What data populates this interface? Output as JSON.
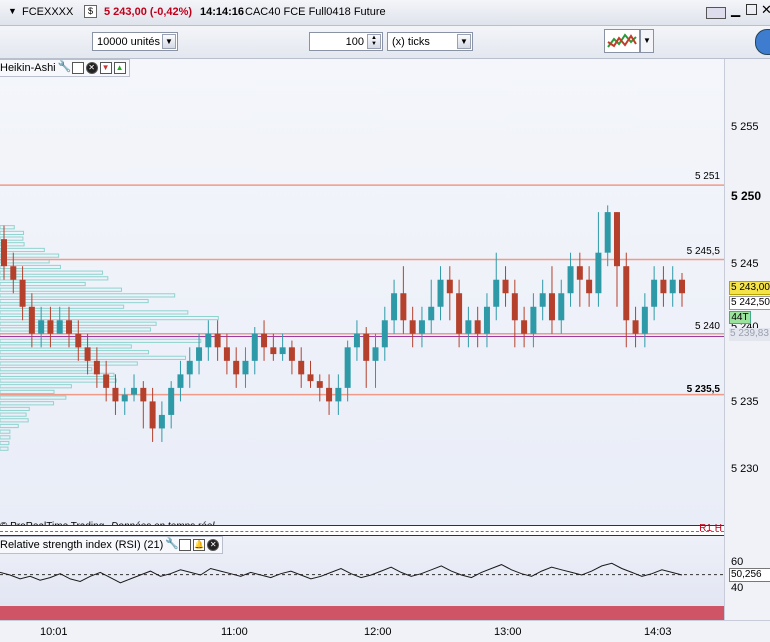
{
  "titlebar": {
    "instrument": "FCEXXXX",
    "price_change": "5 243,00 (-0,42%)",
    "time": "14:14:16",
    "description": "CAC40 FCE Full0418 Future"
  },
  "toolbar": {
    "quantity": "10000 unités",
    "ticks_value": "100",
    "ticks_unit": "(x) ticks"
  },
  "price_panel": {
    "label": "Heikin-Ashi",
    "footer": "© ProRealTime Trading",
    "footer_note": "Données en temps réel",
    "corner_label": "R1 H",
    "levels": [
      "5 251",
      "5 245,5",
      "5 240",
      "5 235,5"
    ],
    "yaxis_ticks": [
      "5 255",
      "5 250",
      "5 245",
      "5 240",
      "5 235",
      "5 230"
    ],
    "last_price": "5 243,00",
    "price_2": "5 242,50",
    "volume_tag": "44T",
    "faded_price": "5 239,83"
  },
  "rsi_panel": {
    "label": "Relative strength index (RSI) (21)",
    "ticks": [
      "60",
      "40"
    ],
    "value": "50,256"
  },
  "time_axis": [
    "10:01",
    "11:00",
    "12:00",
    "13:00",
    "14:03"
  ],
  "colors": {
    "up": "#2e9aa8",
    "down": "#b5412d",
    "level_line": "#f29a88",
    "purple_line": "#9a3aa3",
    "profile": "#8fd3cf",
    "last_price_bg": "#f5e34a",
    "volume_bg": "#9be39d"
  },
  "chart_data": {
    "type": "candlestick",
    "ylim": [
      5227,
      5257
    ],
    "candles": [
      {
        "o": 5247,
        "c": 5245,
        "h": 5248,
        "l": 5244
      },
      {
        "o": 5245,
        "c": 5244,
        "h": 5246,
        "l": 5243
      },
      {
        "o": 5244,
        "c": 5242,
        "h": 5245,
        "l": 5241
      },
      {
        "o": 5242,
        "c": 5240,
        "h": 5243,
        "l": 5239
      },
      {
        "o": 5240,
        "c": 5241,
        "h": 5242,
        "l": 5239
      },
      {
        "o": 5241,
        "c": 5240,
        "h": 5242,
        "l": 5239
      },
      {
        "o": 5240,
        "c": 5241,
        "h": 5242,
        "l": 5240
      },
      {
        "o": 5241,
        "c": 5240,
        "h": 5242,
        "l": 5239
      },
      {
        "o": 5240,
        "c": 5239,
        "h": 5241,
        "l": 5238
      },
      {
        "o": 5239,
        "c": 5238,
        "h": 5240,
        "l": 5237
      },
      {
        "o": 5238,
        "c": 5237,
        "h": 5239,
        "l": 5236
      },
      {
        "o": 5237,
        "c": 5236,
        "h": 5238,
        "l": 5235
      },
      {
        "o": 5236,
        "c": 5235,
        "h": 5237,
        "l": 5234
      },
      {
        "o": 5235,
        "c": 5235.5,
        "h": 5236,
        "l": 5234
      },
      {
        "o": 5235.5,
        "c": 5236,
        "h": 5237,
        "l": 5235
      },
      {
        "o": 5236,
        "c": 5235,
        "h": 5236.5,
        "l": 5233
      },
      {
        "o": 5235,
        "c": 5233,
        "h": 5236,
        "l": 5232
      },
      {
        "o": 5233,
        "c": 5234,
        "h": 5235,
        "l": 5232
      },
      {
        "o": 5234,
        "c": 5236,
        "h": 5236.5,
        "l": 5233
      },
      {
        "o": 5236,
        "c": 5237,
        "h": 5238,
        "l": 5235
      },
      {
        "o": 5237,
        "c": 5238,
        "h": 5239,
        "l": 5236
      },
      {
        "o": 5238,
        "c": 5239,
        "h": 5240,
        "l": 5237
      },
      {
        "o": 5239,
        "c": 5240,
        "h": 5241,
        "l": 5238
      },
      {
        "o": 5240,
        "c": 5239,
        "h": 5241,
        "l": 5238
      },
      {
        "o": 5239,
        "c": 5238,
        "h": 5240,
        "l": 5237
      },
      {
        "o": 5238,
        "c": 5237,
        "h": 5239,
        "l": 5236
      },
      {
        "o": 5237,
        "c": 5238,
        "h": 5239,
        "l": 5236
      },
      {
        "o": 5238,
        "c": 5240,
        "h": 5240.5,
        "l": 5237
      },
      {
        "o": 5240,
        "c": 5239,
        "h": 5241,
        "l": 5238
      },
      {
        "o": 5239,
        "c": 5238.5,
        "h": 5240,
        "l": 5238
      },
      {
        "o": 5238.5,
        "c": 5239,
        "h": 5240,
        "l": 5238
      },
      {
        "o": 5239,
        "c": 5238,
        "h": 5239.5,
        "l": 5237
      },
      {
        "o": 5238,
        "c": 5237,
        "h": 5239,
        "l": 5236
      },
      {
        "o": 5237,
        "c": 5236.5,
        "h": 5238,
        "l": 5236
      },
      {
        "o": 5236.5,
        "c": 5236,
        "h": 5237,
        "l": 5235
      },
      {
        "o": 5236,
        "c": 5235,
        "h": 5237,
        "l": 5234
      },
      {
        "o": 5235,
        "c": 5236,
        "h": 5237,
        "l": 5234
      },
      {
        "o": 5236,
        "c": 5239,
        "h": 5239.5,
        "l": 5235
      },
      {
        "o": 5239,
        "c": 5240,
        "h": 5241,
        "l": 5238
      },
      {
        "o": 5240,
        "c": 5238,
        "h": 5240.5,
        "l": 5236
      },
      {
        "o": 5238,
        "c": 5239,
        "h": 5240,
        "l": 5236
      },
      {
        "o": 5239,
        "c": 5241,
        "h": 5242,
        "l": 5238
      },
      {
        "o": 5241,
        "c": 5243,
        "h": 5244,
        "l": 5240
      },
      {
        "o": 5243,
        "c": 5241,
        "h": 5245,
        "l": 5240
      },
      {
        "o": 5241,
        "c": 5240,
        "h": 5242,
        "l": 5239
      },
      {
        "o": 5240,
        "c": 5241,
        "h": 5242,
        "l": 5239
      },
      {
        "o": 5241,
        "c": 5242,
        "h": 5244,
        "l": 5240
      },
      {
        "o": 5242,
        "c": 5244,
        "h": 5245,
        "l": 5241
      },
      {
        "o": 5244,
        "c": 5243,
        "h": 5245,
        "l": 5241
      },
      {
        "o": 5243,
        "c": 5240,
        "h": 5244,
        "l": 5239
      },
      {
        "o": 5240,
        "c": 5241,
        "h": 5242,
        "l": 5239
      },
      {
        "o": 5241,
        "c": 5240,
        "h": 5242,
        "l": 5239
      },
      {
        "o": 5240,
        "c": 5242,
        "h": 5243,
        "l": 5239
      },
      {
        "o": 5242,
        "c": 5244,
        "h": 5246,
        "l": 5241
      },
      {
        "o": 5244,
        "c": 5243,
        "h": 5245,
        "l": 5242
      },
      {
        "o": 5243,
        "c": 5241,
        "h": 5244,
        "l": 5239
      },
      {
        "o": 5241,
        "c": 5240,
        "h": 5242,
        "l": 5239
      },
      {
        "o": 5240,
        "c": 5242,
        "h": 5243,
        "l": 5239
      },
      {
        "o": 5242,
        "c": 5243,
        "h": 5244,
        "l": 5241
      },
      {
        "o": 5243,
        "c": 5241,
        "h": 5245,
        "l": 5240
      },
      {
        "o": 5241,
        "c": 5243,
        "h": 5244,
        "l": 5240
      },
      {
        "o": 5243,
        "c": 5245,
        "h": 5246,
        "l": 5242
      },
      {
        "o": 5245,
        "c": 5244,
        "h": 5246,
        "l": 5242
      },
      {
        "o": 5244,
        "c": 5243,
        "h": 5245,
        "l": 5242
      },
      {
        "o": 5243,
        "c": 5246,
        "h": 5249,
        "l": 5242
      },
      {
        "o": 5246,
        "c": 5249,
        "h": 5249.5,
        "l": 5245
      },
      {
        "o": 5249,
        "c": 5245,
        "h": 5249,
        "l": 5242
      },
      {
        "o": 5245,
        "c": 5241,
        "h": 5246,
        "l": 5239
      },
      {
        "o": 5241,
        "c": 5240,
        "h": 5242,
        "l": 5239
      },
      {
        "o": 5240,
        "c": 5242,
        "h": 5243,
        "l": 5239
      },
      {
        "o": 5242,
        "c": 5244,
        "h": 5245,
        "l": 5241
      },
      {
        "o": 5244,
        "c": 5243,
        "h": 5245,
        "l": 5242
      },
      {
        "o": 5243,
        "c": 5244,
        "h": 5245,
        "l": 5242
      },
      {
        "o": 5244,
        "c": 5243,
        "h": 5244.5,
        "l": 5242
      }
    ],
    "hlines": [
      5251,
      5245.5,
      5240,
      5235.5
    ],
    "rsi": {
      "ylim": [
        0,
        100
      ],
      "reference": 50.256,
      "values": [
        52,
        50,
        47,
        49,
        46,
        48,
        51,
        47,
        45,
        49,
        52,
        48,
        44,
        47,
        50,
        53,
        49,
        51,
        54,
        52,
        50,
        55,
        53,
        51,
        49,
        52,
        50,
        48,
        51,
        53,
        50,
        47,
        49,
        52,
        55,
        51,
        48,
        50,
        53,
        56,
        52,
        49,
        51,
        54,
        57,
        53,
        50,
        48,
        52,
        55,
        58,
        54,
        51,
        49,
        53,
        56,
        54,
        52,
        50,
        53,
        57,
        59,
        55,
        52,
        49,
        51,
        54,
        52,
        50
      ]
    }
  }
}
